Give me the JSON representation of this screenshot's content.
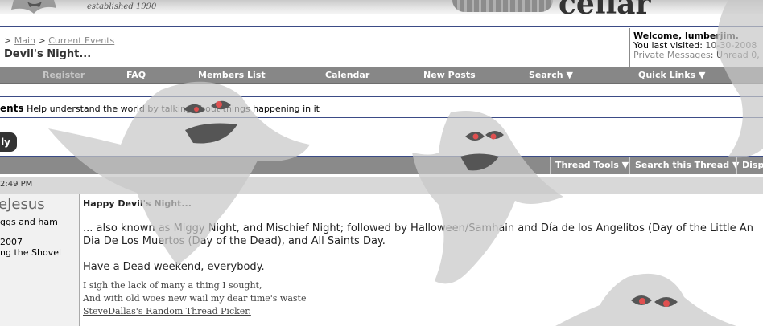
{
  "banner": {
    "tagline": "established 1990",
    "logo": "cellar"
  },
  "breadcrumb": {
    "separator1": ">",
    "main": "Main",
    "separator2": ">",
    "current": "Current Events"
  },
  "thread_heading": "Devil's Night...",
  "welcome": {
    "greeting": "Welcome, lumberjim.",
    "last_visited_label": "You last visited:",
    "last_visited_value": "10-30-2008",
    "pm_label": "Private Messages",
    "pm_unread": ": Unread 0,"
  },
  "navbar": [
    "Register",
    "FAQ",
    "Members List",
    "Calendar",
    "New Posts",
    "Search",
    "Quick Links"
  ],
  "forum": {
    "name": "ents",
    "description": "Help understand the world by talking about things happening in it"
  },
  "reply_label": "ly",
  "toolbar": {
    "thread_tools": "Thread Tools",
    "search_thread": "Search this Thread",
    "display": "Displ"
  },
  "post": {
    "date": "2:49 PM",
    "username": "eJesus",
    "user_title": "ggs and ham",
    "join_date": " 2007",
    "location": "ng the Shovel",
    "title": "Happy Devil's Night...",
    "line1": "... also known as Miggy Night, and Mischief Night; followed by Halloween/Samhain and Día de los Angelitos (Day of the Little An",
    "line2": "Dia De Los Muertos (Day of the Dead), and All Saints Day.",
    "line3": "Have a Dead weekend, everybody.",
    "sig1": "I sigh the lack of many a thing I sought,",
    "sig2": "And with old woes new wail my dear time's waste",
    "sig_link": "SteveDallas's Random Thread Picker."
  },
  "colors": {
    "nav_bg": "#878787",
    "rule": "#3b4b86",
    "ghost": "#c8c8c8",
    "eye": "#e05050"
  }
}
